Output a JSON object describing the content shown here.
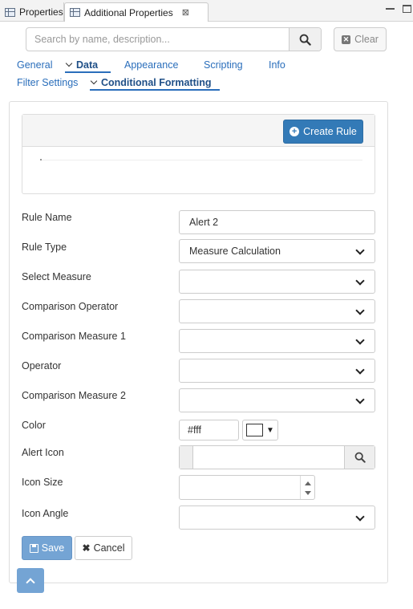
{
  "tabs": {
    "properties_label": "Properties",
    "additional_label": "Additional Properties",
    "close_glyph": "⊠"
  },
  "search": {
    "placeholder": "Search by name, description...",
    "clear_label": "Clear"
  },
  "nav": {
    "row1": [
      "General",
      "Data",
      "Appearance",
      "Scripting",
      "Info"
    ],
    "row2": [
      "Filter Settings",
      "Conditional Formatting"
    ],
    "active_row1": "Data",
    "active_row2": "Conditional Formatting"
  },
  "rules": {
    "create_label": "Create Rule"
  },
  "form": {
    "rule_name": {
      "label": "Rule Name",
      "value": "Alert 2"
    },
    "rule_type": {
      "label": "Rule Type",
      "value": "Measure Calculation"
    },
    "select_measure": {
      "label": "Select Measure",
      "value": ""
    },
    "comparison_operator": {
      "label": "Comparison Operator",
      "value": ""
    },
    "comparison_measure_1": {
      "label": "Comparison Measure 1",
      "value": ""
    },
    "operator": {
      "label": "Operator",
      "value": ""
    },
    "comparison_measure_2": {
      "label": "Comparison Measure 2",
      "value": ""
    },
    "color": {
      "label": "Color",
      "value": "#fff",
      "swatch": "#ffffff"
    },
    "alert_icon": {
      "label": "Alert Icon",
      "value": ""
    },
    "icon_size": {
      "label": "Icon Size",
      "value": ""
    },
    "icon_angle": {
      "label": "Icon Angle",
      "value": ""
    }
  },
  "actions": {
    "save_label": "Save",
    "cancel_label": "Cancel"
  },
  "colors": {
    "primary": "#337ab7",
    "primary_disabled": "#74a4d4",
    "link": "#2a6ebb"
  }
}
